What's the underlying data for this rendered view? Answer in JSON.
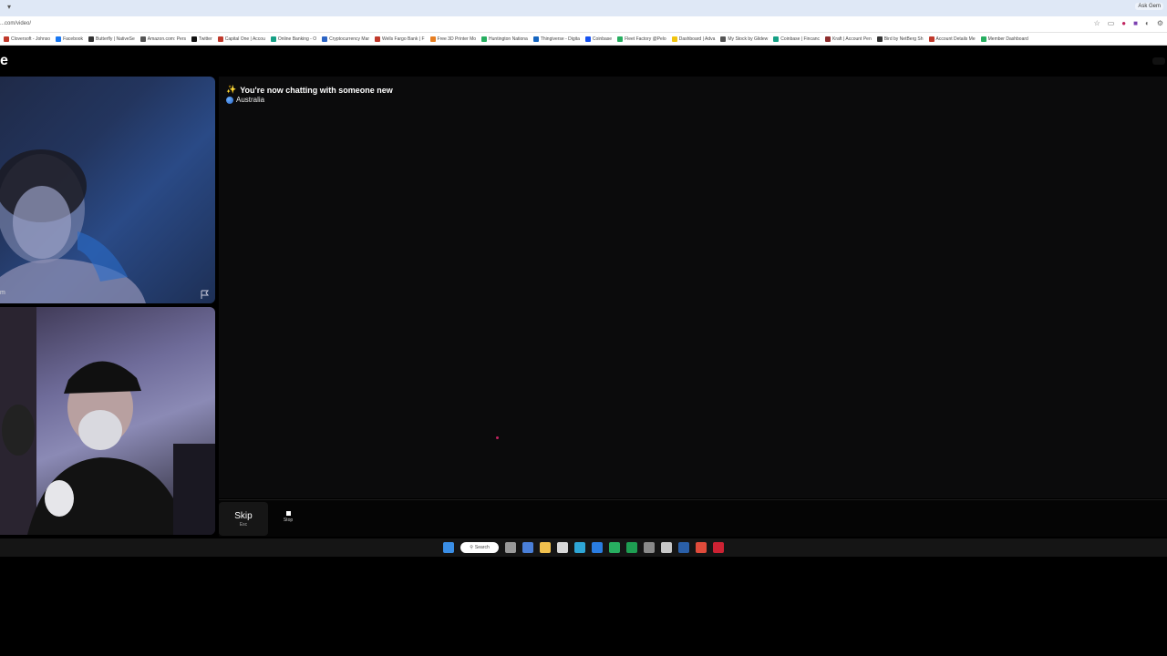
{
  "browser": {
    "tab_right_label": "Ask Gem",
    "url": "...com/video/",
    "bookmarks": [
      {
        "label": "Cloversoft - Johnso",
        "color": "#c0392b"
      },
      {
        "label": "Facebook",
        "color": "#1877f2"
      },
      {
        "label": "Butterfly | NativeSe",
        "color": "#333333"
      },
      {
        "label": "Amazon.com: Pers",
        "color": "#555555"
      },
      {
        "label": "Twitter",
        "color": "#111111"
      },
      {
        "label": "Capital One | Accou",
        "color": "#c0392b"
      },
      {
        "label": "Online Banking - O",
        "color": "#16a085"
      },
      {
        "label": "Cryptocurrency Mar",
        "color": "#2c64c4"
      },
      {
        "label": "Wells Fargo Bank | F",
        "color": "#c0392b"
      },
      {
        "label": "Free 3D Printer Mo",
        "color": "#e67e22"
      },
      {
        "label": "Huntington Nationa",
        "color": "#27ae60"
      },
      {
        "label": "Thingiverse - Digita",
        "color": "#1565c0"
      },
      {
        "label": "Coinbase",
        "color": "#1652f0"
      },
      {
        "label": "Fleet Factory @Pelo",
        "color": "#27ae60"
      },
      {
        "label": "Dashboard | Adva",
        "color": "#f1c40f"
      },
      {
        "label": "My Stock by Glidew",
        "color": "#555555"
      },
      {
        "label": "Coinbase | Fincanc",
        "color": "#16a085"
      },
      {
        "label": "Kraft | Account Pen",
        "color": "#8e2d2d"
      },
      {
        "label": "Bird by NetBerg Sh",
        "color": "#333333"
      },
      {
        "label": "Account Details Me",
        "color": "#c0392b"
      },
      {
        "label": "Member Dashboard",
        "color": "#27ae60"
      }
    ]
  },
  "page": {
    "logo": "e",
    "remote_name": "m",
    "chat": {
      "new_chat_message": "You're now chatting with someone new",
      "sparkle": "✨",
      "location": "Australia"
    },
    "controls": {
      "skip_label": "Skip",
      "skip_hint": "Esc",
      "stop_label": "Stop"
    }
  },
  "taskbar": {
    "search_label": "Search",
    "icons": [
      {
        "name": "windows-start-icon",
        "color": "#3a8ee6"
      },
      {
        "name": "search-field",
        "color": "#ffffff"
      },
      {
        "name": "task-view-icon",
        "color": "#9a9a9a"
      },
      {
        "name": "widgets-icon",
        "color": "#4a7fd8"
      },
      {
        "name": "file-explorer-icon",
        "color": "#f2c14e"
      },
      {
        "name": "store-icon",
        "color": "#d8d8d8"
      },
      {
        "name": "edge-icon",
        "color": "#2ea6d6"
      },
      {
        "name": "photoshop-icon",
        "color": "#2a7de1"
      },
      {
        "name": "xbox-icon",
        "color": "#27ae60"
      },
      {
        "name": "spreadsheet-icon",
        "color": "#1e9e52"
      },
      {
        "name": "calculator-icon",
        "color": "#8a8a8a"
      },
      {
        "name": "snipping-tool-icon",
        "color": "#c8c8c8"
      },
      {
        "name": "steam-icon",
        "color": "#2a5fa8"
      },
      {
        "name": "chrome-icon",
        "color": "#e04b3b"
      },
      {
        "name": "opera-icon",
        "color": "#cc2233"
      }
    ]
  }
}
